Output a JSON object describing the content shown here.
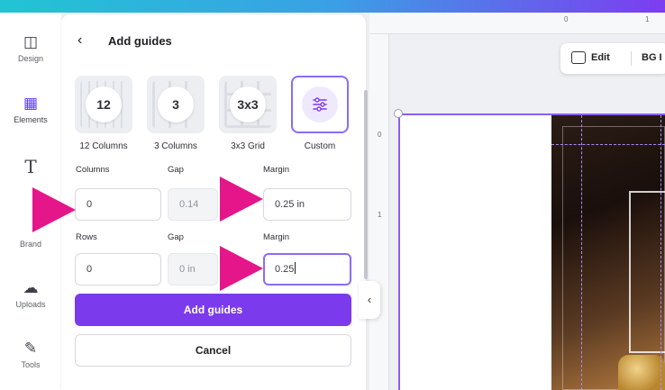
{
  "colors": {
    "accent": "#7c3aed",
    "focus_border": "#8b6cf7",
    "annotation_arrow": "#e4168a"
  },
  "sidebar": {
    "items": [
      {
        "label": "Design",
        "icon": "layout-icon"
      },
      {
        "label": "Elements",
        "icon": "shapes-icon"
      },
      {
        "label": "T",
        "icon": "text-icon"
      },
      {
        "label": "Brand",
        "icon": "brand-icon"
      },
      {
        "label": "Uploads",
        "icon": "cloud-upload-icon"
      },
      {
        "label": "Tools",
        "icon": "pen-icon"
      }
    ],
    "icons": {
      "layout": "◫",
      "shapes": "▦",
      "text": "T",
      "upload": "☁",
      "pen": "✎"
    }
  },
  "panel": {
    "back_icon": "‹",
    "title": "Add guides",
    "presets": [
      {
        "value": "12",
        "label": "12 Columns"
      },
      {
        "value": "3",
        "label": "3 Columns"
      },
      {
        "value": "3x3",
        "label": "3x3 Grid"
      },
      {
        "value": "",
        "label": "Custom",
        "icon": "sliders-icon"
      }
    ],
    "columns_row": {
      "labels": {
        "columns": "Columns",
        "gap": "Gap",
        "margin": "Margin"
      },
      "columns_value": "0",
      "gap_value": "0.14",
      "margin_value": "0.25 in"
    },
    "rows_row": {
      "labels": {
        "rows": "Rows",
        "gap": "Gap",
        "margin": "Margin"
      },
      "rows_value": "0",
      "gap_value": "0 in",
      "margin_value": "0.25"
    },
    "add_button": "Add guides",
    "cancel_button": "Cancel"
  },
  "canvas": {
    "ruler_top": [
      "0",
      "1"
    ],
    "ruler_left": [
      "0",
      "1"
    ],
    "toolbar": {
      "edit_label": "Edit",
      "bg_label": "BG I"
    },
    "collapse_icon": "‹"
  }
}
